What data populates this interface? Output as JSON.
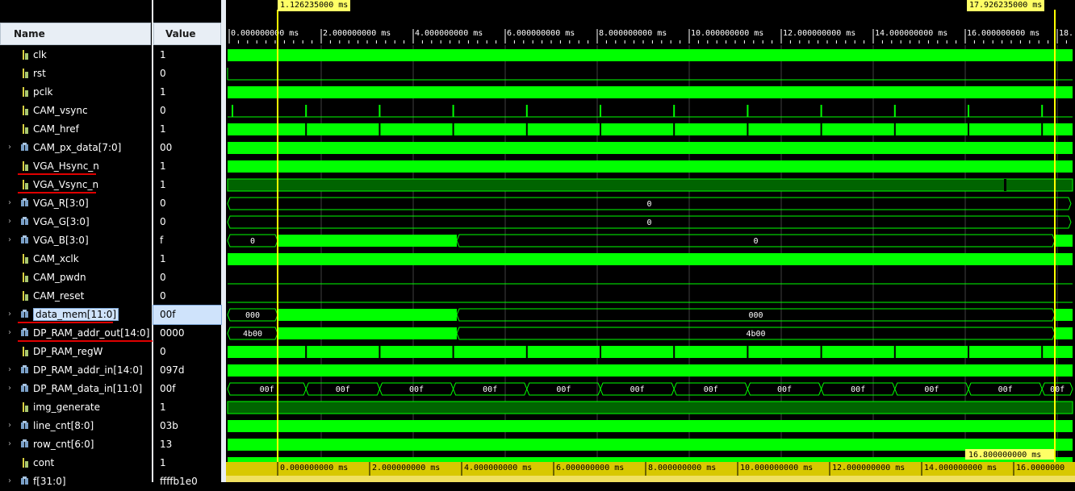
{
  "columns": {
    "name": "Name",
    "value": "Value"
  },
  "markers": {
    "cursor_left": "1.126235000 ms",
    "cursor_right": "17.926235000 ms",
    "delta": "16.800000000 ms"
  },
  "time_ruler": {
    "labels": [
      "0.000000000 ms",
      "2.000000000 ms",
      "4.000000000 ms",
      "6.000000000 ms",
      "8.000000000 ms",
      "10.000000000 ms",
      "12.000000000 ms",
      "14.000000000 ms",
      "16.000000000 ms",
      "18."
    ]
  },
  "bottom_ruler": {
    "labels": [
      "0.000000000 ms",
      "2.000000000 ms",
      "4.000000000 ms",
      "6.000000000 ms",
      "8.000000000 ms",
      "10.000000000 ms",
      "12.000000000 ms",
      "14.000000000 ms",
      "16.0000000"
    ]
  },
  "signals": [
    {
      "name": "clk",
      "value": "1",
      "expandable": false,
      "kind": "bit"
    },
    {
      "name": "rst",
      "value": "0",
      "expandable": false,
      "kind": "bit"
    },
    {
      "name": "pclk",
      "value": "1",
      "expandable": false,
      "kind": "bit"
    },
    {
      "name": "CAM_vsync",
      "value": "0",
      "expandable": false,
      "kind": "bit"
    },
    {
      "name": "CAM_href",
      "value": "1",
      "expandable": false,
      "kind": "bit"
    },
    {
      "name": "CAM_px_data[7:0]",
      "value": "00",
      "expandable": true,
      "kind": "bus"
    },
    {
      "name": "VGA_Hsync_n",
      "value": "1",
      "expandable": false,
      "kind": "bit",
      "underlined": true
    },
    {
      "name": "VGA_Vsync_n",
      "value": "1",
      "expandable": false,
      "kind": "bit",
      "underlined": true
    },
    {
      "name": "VGA_R[3:0]",
      "value": "0",
      "expandable": true,
      "kind": "bus"
    },
    {
      "name": "VGA_G[3:0]",
      "value": "0",
      "expandable": true,
      "kind": "bus"
    },
    {
      "name": "VGA_B[3:0]",
      "value": "f",
      "expandable": true,
      "kind": "bus"
    },
    {
      "name": "CAM_xclk",
      "value": "1",
      "expandable": false,
      "kind": "bit"
    },
    {
      "name": "CAM_pwdn",
      "value": "0",
      "expandable": false,
      "kind": "bit"
    },
    {
      "name": "CAM_reset",
      "value": "0",
      "expandable": false,
      "kind": "bit"
    },
    {
      "name": "data_mem[11:0]",
      "value": "00f",
      "expandable": true,
      "kind": "bus",
      "selected": true,
      "underlined": true
    },
    {
      "name": "DP_RAM_addr_out[14:0]",
      "value": "0000",
      "expandable": true,
      "kind": "bus",
      "underlined": true
    },
    {
      "name": "DP_RAM_regW",
      "value": "0",
      "expandable": false,
      "kind": "bit"
    },
    {
      "name": "DP_RAM_addr_in[14:0]",
      "value": "097d",
      "expandable": true,
      "kind": "bus"
    },
    {
      "name": "DP_RAM_data_in[11:0]",
      "value": "00f",
      "expandable": true,
      "kind": "bus"
    },
    {
      "name": "img_generate",
      "value": "1",
      "expandable": false,
      "kind": "bit"
    },
    {
      "name": "line_cnt[8:0]",
      "value": "03b",
      "expandable": true,
      "kind": "bus"
    },
    {
      "name": "row_cnt[6:0]",
      "value": "13",
      "expandable": true,
      "kind": "bus"
    },
    {
      "name": "cont",
      "value": "1",
      "expandable": false,
      "kind": "bit"
    },
    {
      "name": "f[31:0]",
      "value": "ffffb1e0",
      "expandable": true,
      "kind": "bus"
    }
  ],
  "wave_labels": {
    "vga_r": "0",
    "vga_g": "0",
    "vga_b_before": "0",
    "vga_b_after": "0",
    "data_mem_before": "000",
    "data_mem_after": "000",
    "addr_out_before": "4b00",
    "addr_out_after": "4b00",
    "data_in_segments": [
      "00f",
      "00f",
      "00f",
      "00f",
      "00f",
      "00f",
      "00f",
      "00f",
      "00f",
      "00f",
      "00f",
      "00f"
    ]
  },
  "colors": {
    "wave_green": "#00ff00",
    "wave_dark_green": "#006400",
    "cursor_yellow": "#ffff00",
    "grid": "#404040",
    "underline_red": "#e00000"
  }
}
